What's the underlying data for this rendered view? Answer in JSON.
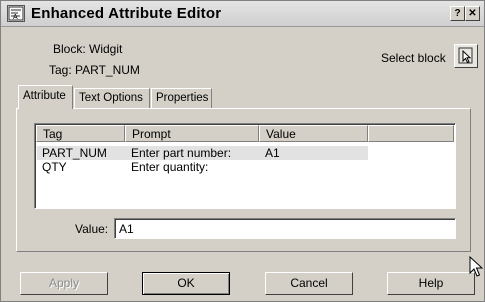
{
  "window": {
    "title": "Enhanced Attribute Editor",
    "help_glyph": "?",
    "close_glyph": "✕"
  },
  "info": {
    "block": "Block: Widgit",
    "tag": "Tag: PART_NUM",
    "select_block": "Select block"
  },
  "tabs": [
    {
      "label": "Attribute",
      "active": true
    },
    {
      "label": "Text Options",
      "active": false
    },
    {
      "label": "Properties",
      "active": false
    }
  ],
  "list": {
    "columns": [
      "Tag",
      "Prompt",
      "Value"
    ],
    "rows": [
      {
        "tag": "PART_NUM",
        "prompt": "Enter part number:",
        "value": "A1",
        "selected": true
      },
      {
        "tag": "QTY",
        "prompt": "Enter quantity:",
        "value": "",
        "selected": false
      }
    ]
  },
  "value_field": {
    "label": "Value:",
    "value": "A1"
  },
  "buttons": {
    "apply": "Apply",
    "ok": "OK",
    "cancel": "Cancel",
    "help": "Help"
  },
  "icons": {
    "app": "attribute-editor-icon",
    "select_block": "pick-cursor-icon",
    "pointer": "mouse-pointer-icon"
  }
}
